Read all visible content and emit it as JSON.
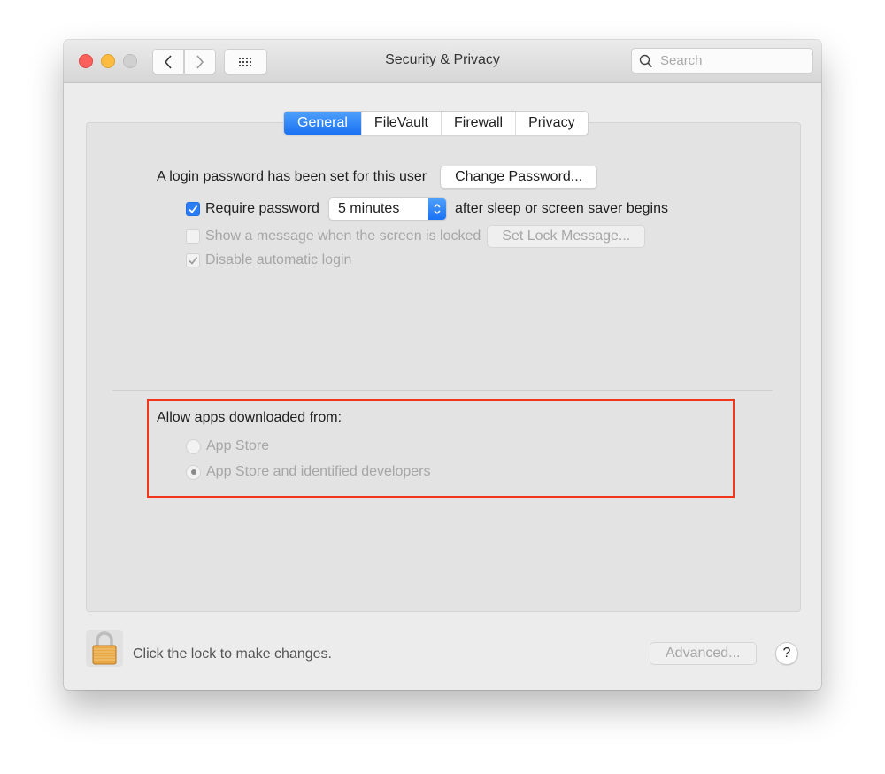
{
  "window": {
    "title": "Security & Privacy",
    "search_placeholder": "Search"
  },
  "tabs": [
    {
      "label": "General",
      "active": true
    },
    {
      "label": "FileVault",
      "active": false
    },
    {
      "label": "Firewall",
      "active": false
    },
    {
      "label": "Privacy",
      "active": false
    }
  ],
  "general": {
    "login_password_text": "A login password has been set for this user",
    "change_password_label": "Change Password...",
    "require_password_label": "Require password",
    "require_password_checked": true,
    "require_password_delay": "5 minutes",
    "require_password_suffix": "after sleep or screen saver begins",
    "show_message_label": "Show a message when the screen is locked",
    "show_message_checked": false,
    "set_lock_message_label": "Set Lock Message...",
    "disable_auto_login_label": "Disable automatic login",
    "disable_auto_login_checked": true
  },
  "allow_apps": {
    "heading": "Allow apps downloaded from:",
    "options": [
      {
        "label": "App Store",
        "selected": false
      },
      {
        "label": "App Store and identified developers",
        "selected": true
      }
    ],
    "highlight_color": "#f2361c"
  },
  "footer": {
    "lock_text": "Click the lock to make changes.",
    "advanced_label": "Advanced...",
    "help_label": "?"
  },
  "colors": {
    "accent": "#1a71f3",
    "close": "#fc605c",
    "minimize": "#fdbc40"
  }
}
